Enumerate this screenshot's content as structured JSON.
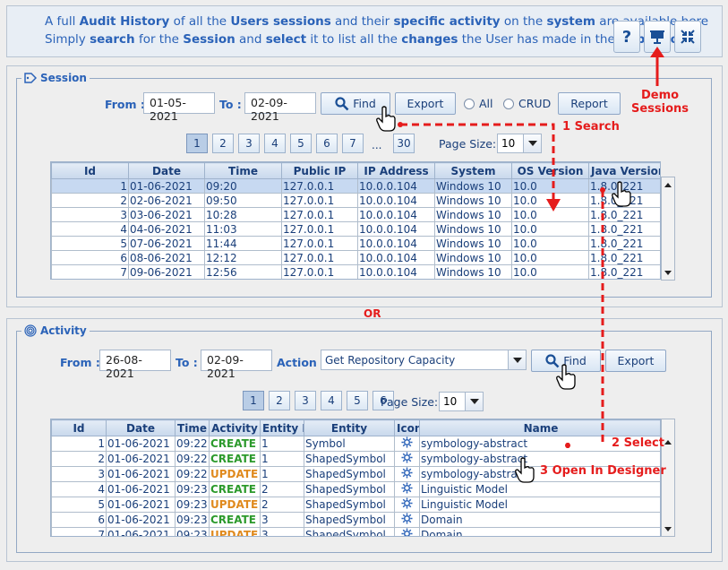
{
  "intro": {
    "line1": [
      {
        "t": "A full ",
        "b": false
      },
      {
        "t": "Audit History",
        "b": true
      },
      {
        "t": " of all the ",
        "b": false
      },
      {
        "t": "Users sessions",
        "b": true
      },
      {
        "t": " and their ",
        "b": false
      },
      {
        "t": "specific activity",
        "b": true
      },
      {
        "t": " on the ",
        "b": false
      },
      {
        "t": "system",
        "b": true
      },
      {
        "t": " are available here",
        "b": false
      }
    ],
    "line2": [
      {
        "t": "Simply ",
        "b": false
      },
      {
        "t": "search",
        "b": true
      },
      {
        "t": " for the ",
        "b": false
      },
      {
        "t": "Session",
        "b": true
      },
      {
        "t": " and ",
        "b": false
      },
      {
        "t": "select",
        "b": true
      },
      {
        "t": " it to list all the ",
        "b": false
      },
      {
        "t": "changes",
        "b": true
      },
      {
        "t": " the User has made in the ",
        "b": false
      },
      {
        "t": "Repository",
        "b": true
      }
    ]
  },
  "header_buttons": {
    "help_icon": "help-icon",
    "demo_icon": "presentation-icon",
    "collapse_icon": "collapse-icon"
  },
  "session": {
    "title": "Session",
    "from_label": "From :",
    "from_value": "01-05-2021",
    "to_label": "To :",
    "to_value": "02-09-2021",
    "find_label": "Find",
    "export_label": "Export",
    "radio_all": "All",
    "radio_crud": "CRUD",
    "report_label": "Report",
    "pages": [
      "1",
      "2",
      "3",
      "4",
      "5",
      "6",
      "7",
      "...",
      "30"
    ],
    "active_page": "1",
    "page_size_label": "Page Size:",
    "page_size_value": "10",
    "columns": [
      "Id",
      "Date",
      "Time",
      "Public IP",
      "IP Address",
      "System",
      "OS Version",
      "Java Version"
    ],
    "rows": [
      [
        "1",
        "01-06-2021",
        "09:20",
        "127.0.0.1",
        "10.0.0.104",
        "Windows 10",
        "10.0",
        "1.8.0_221"
      ],
      [
        "2",
        "02-06-2021",
        "09:50",
        "127.0.0.1",
        "10.0.0.104",
        "Windows 10",
        "10.0",
        "1.8.0_221"
      ],
      [
        "3",
        "03-06-2021",
        "10:28",
        "127.0.0.1",
        "10.0.0.104",
        "Windows 10",
        "10.0",
        "1.8.0_221"
      ],
      [
        "4",
        "04-06-2021",
        "11:03",
        "127.0.0.1",
        "10.0.0.104",
        "Windows 10",
        "10.0",
        "1.8.0_221"
      ],
      [
        "5",
        "07-06-2021",
        "11:44",
        "127.0.0.1",
        "10.0.0.104",
        "Windows 10",
        "10.0",
        "1.8.0_221"
      ],
      [
        "6",
        "08-06-2021",
        "12:12",
        "127.0.0.1",
        "10.0.0.104",
        "Windows 10",
        "10.0",
        "1.8.0_221"
      ],
      [
        "7",
        "09-06-2021",
        "12:56",
        "127.0.0.1",
        "10.0.0.104",
        "Windows 10",
        "10.0",
        "1.8.0_221"
      ]
    ],
    "selected_row": 0
  },
  "or_label": "OR",
  "activity": {
    "title": "Activity",
    "from_label": "From :",
    "from_value": "26-08-2021",
    "to_label": "To :",
    "to_value": "02-09-2021",
    "action_label": "Action :",
    "action_value": "Get Repository Capacity",
    "find_label": "Find",
    "export_label": "Export",
    "pages": [
      "1",
      "2",
      "3",
      "4",
      "5",
      "6"
    ],
    "active_page": "1",
    "page_size_label": "Page Size:",
    "page_size_value": "10",
    "columns": [
      "Id",
      "Date",
      "Time",
      "Activity",
      "Entity Id",
      "Entity",
      "Icon",
      "Name"
    ],
    "rows": [
      [
        "1",
        "01-06-2021",
        "09:22",
        "CREATE",
        "1",
        "Symbol",
        "gear-icon",
        "symbology-abstract"
      ],
      [
        "2",
        "01-06-2021",
        "09:22",
        "CREATE",
        "1",
        "ShapedSymbol",
        "gear-icon",
        "symbology-abstract"
      ],
      [
        "3",
        "01-06-2021",
        "09:22",
        "UPDATE",
        "1",
        "ShapedSymbol",
        "gear-icon",
        "symbology-abstract"
      ],
      [
        "4",
        "01-06-2021",
        "09:23",
        "CREATE",
        "2",
        "ShapedSymbol",
        "gear-icon",
        "Linguistic Model"
      ],
      [
        "5",
        "01-06-2021",
        "09:23",
        "UPDATE",
        "2",
        "ShapedSymbol",
        "gear-icon",
        "Linguistic Model"
      ],
      [
        "6",
        "01-06-2021",
        "09:23",
        "CREATE",
        "3",
        "ShapedSymbol",
        "gear-icon",
        "Domain"
      ],
      [
        "7",
        "01-06-2021",
        "09:23",
        "UPDATE",
        "3",
        "ShapedSymbol",
        "gear-icon",
        "Domain"
      ]
    ]
  },
  "annotations": {
    "demo": "Demo\nSessions",
    "step1": "1 Search",
    "step2": "2 Select",
    "step3": "3 Open In Designer"
  },
  "colors": {
    "accent": "#2a62b8",
    "annotation": "#e51c1c",
    "create": "#2c9a2c",
    "update": "#e08a1e"
  }
}
